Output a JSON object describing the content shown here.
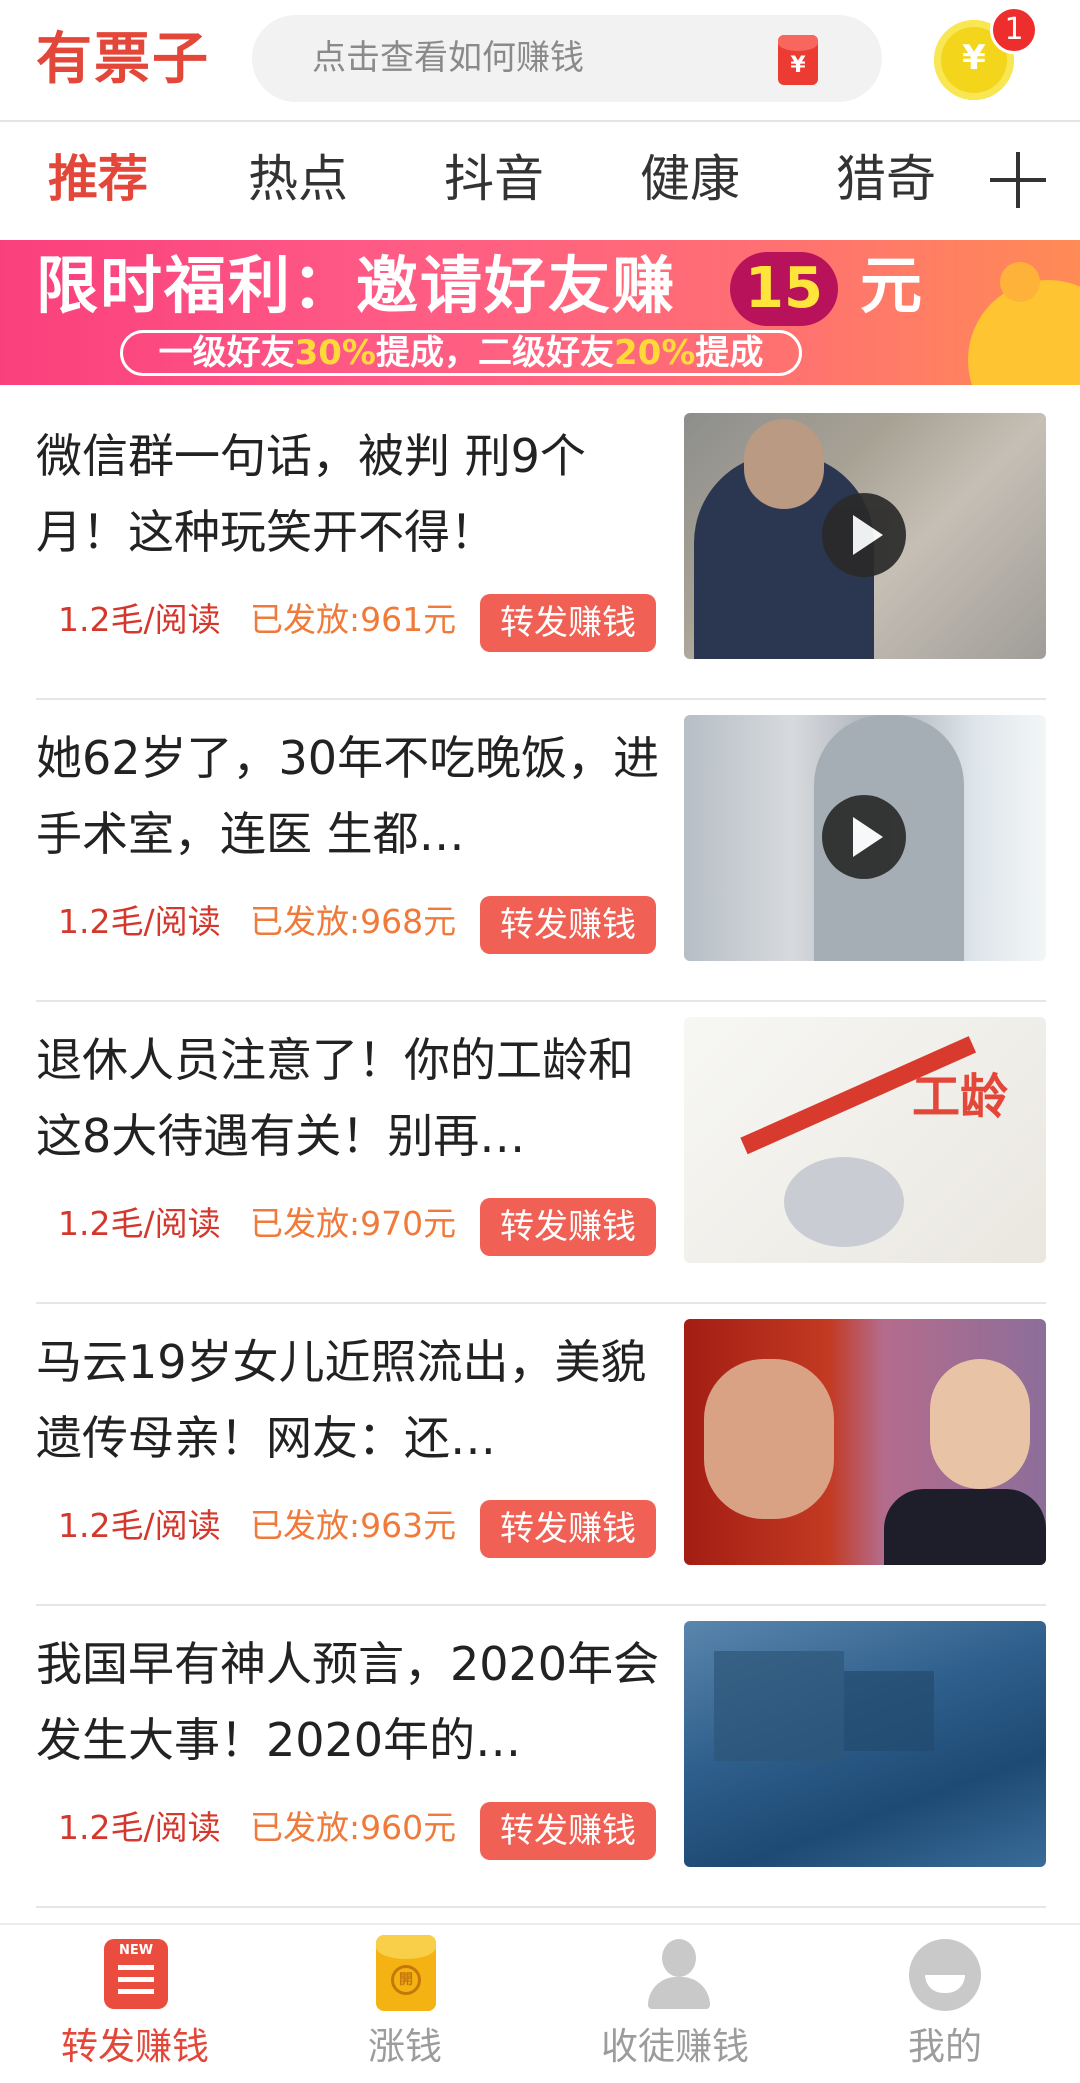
{
  "header": {
    "logo": "有票子",
    "search_placeholder": "点击查看如何赚钱",
    "coin_symbol": "¥",
    "notification_count": "1"
  },
  "tabs": [
    {
      "label": "推荐",
      "active": true
    },
    {
      "label": "热点"
    },
    {
      "label": "抖音"
    },
    {
      "label": "健康"
    },
    {
      "label": "猎奇"
    }
  ],
  "banner": {
    "title": "限时福利：邀请好友赚",
    "amount": "15",
    "unit": "元",
    "sub_part1": "一级好友",
    "sub_pct1": "30%",
    "sub_part2": "提成，二级好友",
    "sub_pct2": "20%",
    "sub_part3": "提成"
  },
  "articles": [
    {
      "title": "微信群一句话，被判 刑9个月！这种玩笑开不得！",
      "rate": "1.2毛/阅读",
      "paid": "已发放:961元",
      "action": "转发赚钱",
      "video": true
    },
    {
      "title": "她62岁了，30年不吃晚饭，进手术室，连医 生都…",
      "rate": "1.2毛/阅读",
      "paid": "已发放:968元",
      "action": "转发赚钱",
      "video": true
    },
    {
      "title": "退休人员注意了！你的工龄和这8大待遇有关！别再…",
      "rate": "1.2毛/阅读",
      "paid": "已发放:970元",
      "action": "转发赚钱",
      "thumb_text": "工龄"
    },
    {
      "title": "马云19岁女儿近照流出，美貌遗传母亲！网友：还…",
      "rate": "1.2毛/阅读",
      "paid": "已发放:963元",
      "action": "转发赚钱"
    },
    {
      "title": "我国早有神人预言，2020年会发生大事！2020年的…",
      "rate": "1.2毛/阅读",
      "paid": "已发放:960元",
      "action": "转发赚钱"
    }
  ],
  "bottom_nav": [
    {
      "label": "转发赚钱",
      "active": true,
      "icon_text": "NEW"
    },
    {
      "label": "涨钱",
      "icon_text": "開"
    },
    {
      "label": "收徒赚钱"
    },
    {
      "label": "我的"
    }
  ],
  "colors": {
    "brand_red": "#e2473a",
    "button_red": "#f06054",
    "paid_orange": "#ef7a3a"
  }
}
